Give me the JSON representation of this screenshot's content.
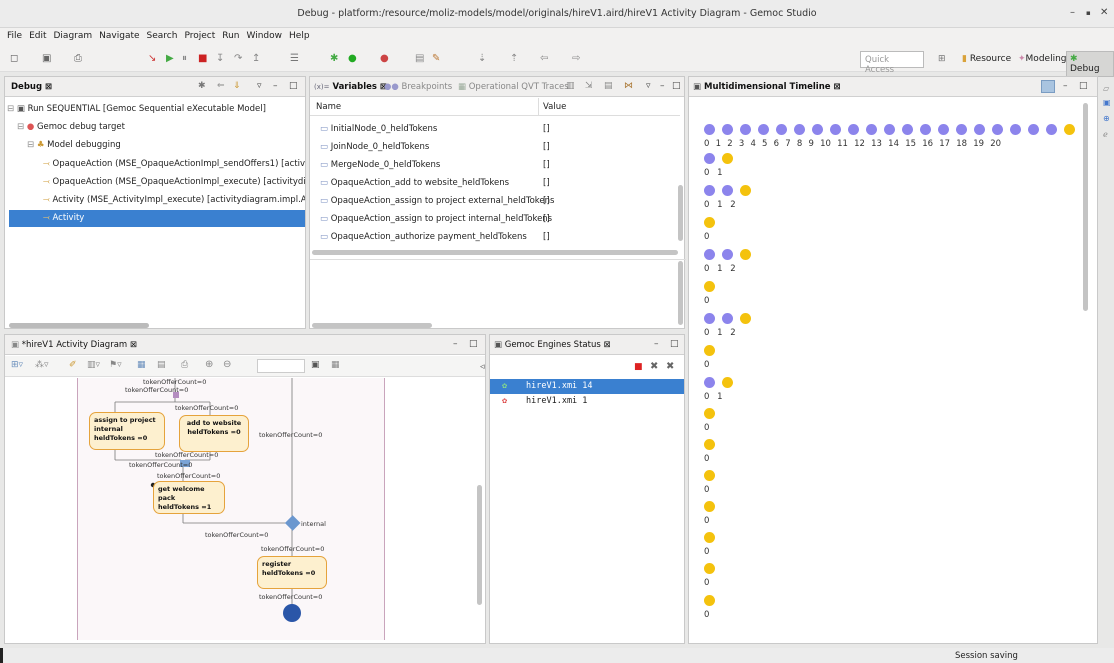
{
  "window": {
    "title": "Debug - platform:/resource/moliz-models/model/originals/hireV1.aird/hireV1 Activity Diagram - Gemoc Studio",
    "controls": [
      "–",
      "▪",
      "✕"
    ]
  },
  "menu": [
    "File",
    "Edit",
    "Diagram",
    "Navigate",
    "Search",
    "Project",
    "Run",
    "Window",
    "Help"
  ],
  "toolbar": {
    "quick_access": "Quick Access",
    "perspectives": [
      "Resource",
      "Modeling",
      "Debug"
    ]
  },
  "debug_view": {
    "tab": "Debug ⊠",
    "items": [
      "Run SEQUENTIAL [Gemoc Sequential eXecutable Model]",
      "Gemoc debug target",
      "Model debugging",
      "OpaqueAction (MSE_OpaqueActionImpl_sendOffers1) [activitydiag",
      "OpaqueAction (MSE_OpaqueActionImpl_execute) [activitydiagram.",
      "Activity (MSE_ActivityImpl_execute) [activitydiagram.impl.Activity",
      "Activity"
    ]
  },
  "variables_view": {
    "tabs": [
      "Variables ⊠",
      "Breakpoints",
      "Operational QVT Traces"
    ],
    "col_name": "Name",
    "col_value": "Value",
    "rows": [
      {
        "name": "InitialNode_0_heldTokens",
        "value": "[]"
      },
      {
        "name": "JoinNode_0_heldTokens",
        "value": "[]"
      },
      {
        "name": "MergeNode_0_heldTokens",
        "value": "[]"
      },
      {
        "name": "OpaqueAction_add to website_heldTokens",
        "value": "[]"
      },
      {
        "name": "OpaqueAction_assign to project external_heldTokens",
        "value": "[]"
      },
      {
        "name": "OpaqueAction_assign to project internal_heldTokens",
        "value": "[]"
      },
      {
        "name": "OpaqueAction_authorize payment_heldTokens",
        "value": "[]"
      }
    ]
  },
  "timeline_view": {
    "tab": "Multidimensional Timeline ⊠",
    "rows": [
      {
        "blue": 20,
        "yellow": 1,
        "labels": "0  1  2  3  4  5  6  7  8  9  10 11 12 13 14 15 16 17 18 19 20"
      },
      {
        "blue": 1,
        "yellow": 1,
        "labels": "0  1"
      },
      {
        "blue": 2,
        "yellow": 1,
        "labels": "0  1  2"
      },
      {
        "blue": 0,
        "yellow": 1,
        "labels": "0"
      },
      {
        "blue": 2,
        "yellow": 1,
        "labels": "0  1  2"
      },
      {
        "blue": 0,
        "yellow": 1,
        "labels": "0"
      },
      {
        "blue": 2,
        "yellow": 1,
        "labels": "0  1  2"
      },
      {
        "blue": 0,
        "yellow": 1,
        "labels": "0"
      },
      {
        "blue": 1,
        "yellow": 1,
        "labels": "0  1"
      },
      {
        "blue": 0,
        "yellow": 1,
        "labels": "0"
      },
      {
        "blue": 0,
        "yellow": 1,
        "labels": "0"
      },
      {
        "blue": 0,
        "yellow": 1,
        "labels": "0"
      },
      {
        "blue": 0,
        "yellow": 1,
        "labels": "0"
      },
      {
        "blue": 0,
        "yellow": 1,
        "labels": "0"
      },
      {
        "blue": 0,
        "yellow": 1,
        "labels": "0"
      },
      {
        "blue": 0,
        "yellow": 1,
        "labels": "0"
      }
    ]
  },
  "diagram_view": {
    "tab": "*hireV1 Activity Diagram ⊠",
    "nodes": [
      {
        "title": "assign to project internal",
        "tokens": "heldTokens =0"
      },
      {
        "title": "add to website",
        "tokens": "heldTokens =0"
      },
      {
        "title": "get welcome pack",
        "tokens": "heldTokens =1"
      },
      {
        "title": "register",
        "tokens": "heldTokens =0"
      }
    ],
    "offer_label": "tokenOfferCount=0",
    "guard_label": "internal"
  },
  "engines_view": {
    "tab": "Gemoc Engines Status ⊠",
    "items": [
      {
        "name": "hireV1.xmi 14",
        "selected": true
      },
      {
        "name": "hireV1.xmi 1",
        "selected": false
      }
    ]
  },
  "status_bar": {
    "message": "Session saving"
  }
}
